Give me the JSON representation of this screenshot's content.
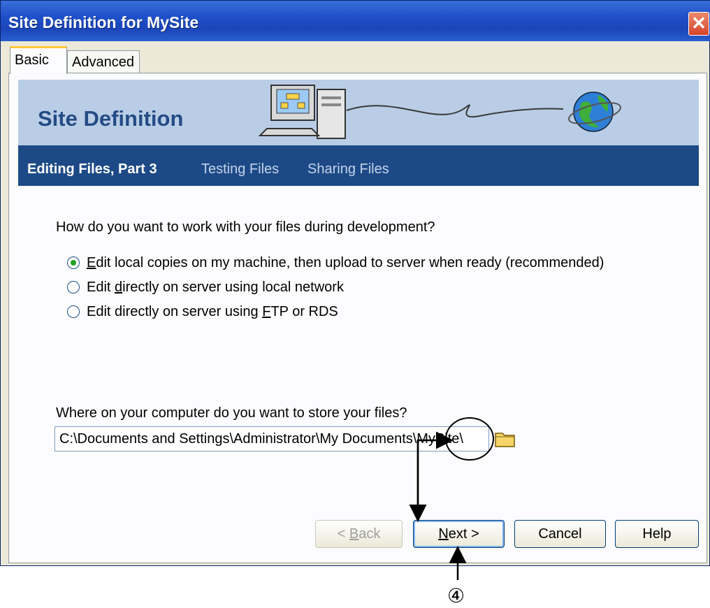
{
  "window": {
    "title": "Site Definition for MySite",
    "close_glyph": "✕"
  },
  "tabs": [
    {
      "label": "Basic",
      "active": true
    },
    {
      "label": "Advanced",
      "active": false
    }
  ],
  "banner": {
    "title": "Site Definition",
    "icons": [
      "computer-icon",
      "globe-icon"
    ]
  },
  "steps": {
    "current": "Editing Files, Part 3",
    "others": [
      "Testing Files",
      "Sharing Files"
    ]
  },
  "question": "How do you want to work with your files during development?",
  "options": [
    {
      "pre": "",
      "key": "E",
      "post": "dit local copies on my machine, then upload to server when ready (recommended)",
      "checked": true
    },
    {
      "pre": "Edit ",
      "key": "d",
      "post": "irectly on server using local network",
      "checked": false
    },
    {
      "pre": "Edit directly on server using ",
      "key": "F",
      "post": "TP or RDS",
      "checked": false
    }
  ],
  "store": {
    "question": "Where on your computer do you want to store your files?",
    "path": "C:\\Documents and Settings\\Administrator\\My Documents\\MySite\\",
    "browse_icon": "folder-icon"
  },
  "buttons": {
    "back": {
      "pre": "< ",
      "key": "B",
      "post": "ack"
    },
    "next": {
      "key": "N",
      "post": "ext >"
    },
    "cancel": "Cancel",
    "help": "Help"
  },
  "annotation": {
    "marker": "④"
  }
}
